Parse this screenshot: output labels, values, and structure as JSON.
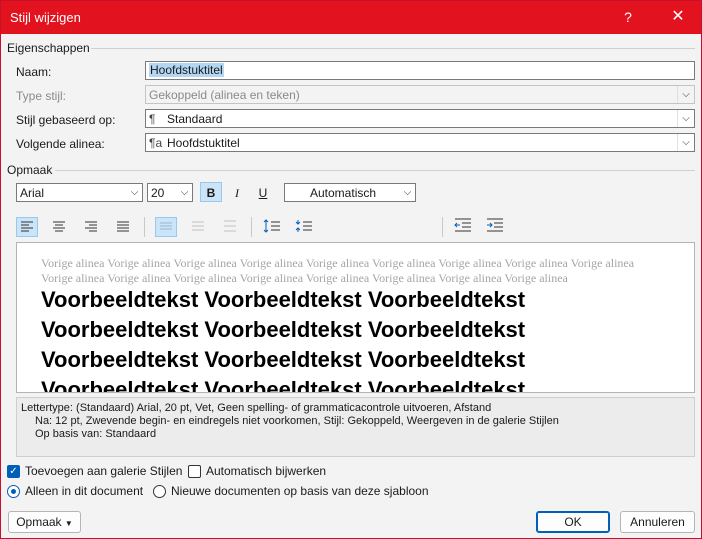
{
  "window": {
    "title": "Stijl wijzigen",
    "help": "?",
    "close": "✕"
  },
  "sections": {
    "properties": "Eigenschappen",
    "format": "Opmaak"
  },
  "fields": {
    "name_label": "Naam:",
    "name_value": "Hoofdstuktitel",
    "type_label": "Type stijl:",
    "type_value": "Gekoppeld (alinea en teken)",
    "based_label": "Stijl gebaseerd op:",
    "based_value": "Standaard",
    "based_glyph": "¶",
    "next_label": "Volgende alinea:",
    "next_value": "Hoofdstuktitel",
    "next_glyph": "¶a"
  },
  "toolbar": {
    "font": "Arial",
    "size": "20",
    "bold": "B",
    "italic": "I",
    "underline": "U",
    "color": "Automatisch"
  },
  "preview": {
    "previous_paragraph": "Vorige alinea Vorige alinea Vorige alinea Vorige alinea Vorige alinea Vorige alinea Vorige alinea Vorige alinea Vorige alinea Vorige alinea Vorige alinea Vorige alinea Vorige alinea Vorige alinea Vorige alinea Vorige alinea Vorige alinea",
    "sample_line": "Voorbeeldtekst Voorbeeldtekst Voorbeeldtekst"
  },
  "description": {
    "line1": "Lettertype: (Standaard) Arial, 20 pt, Vet, Geen spelling- of grammaticacontrole uitvoeren, Afstand",
    "line2": "Na:  12 pt, Zwevende begin- en eindregels niet voorkomen, Stijl: Gekoppeld, Weergeven in de galerie Stijlen",
    "line3": "Op basis van: Standaard"
  },
  "options": {
    "add_gallery": "Toevoegen aan galerie Stijlen",
    "auto_update": "Automatisch bijwerken",
    "only_doc": "Alleen in dit document",
    "new_docs": "Nieuwe documenten op basis van deze sjabloon"
  },
  "buttons": {
    "format": "Opmaak",
    "ok": "OK",
    "cancel": "Annuleren"
  },
  "colors": {
    "titlebar": "#e3121f",
    "accent": "#005fb8",
    "active_tool": "#cce4f7"
  }
}
